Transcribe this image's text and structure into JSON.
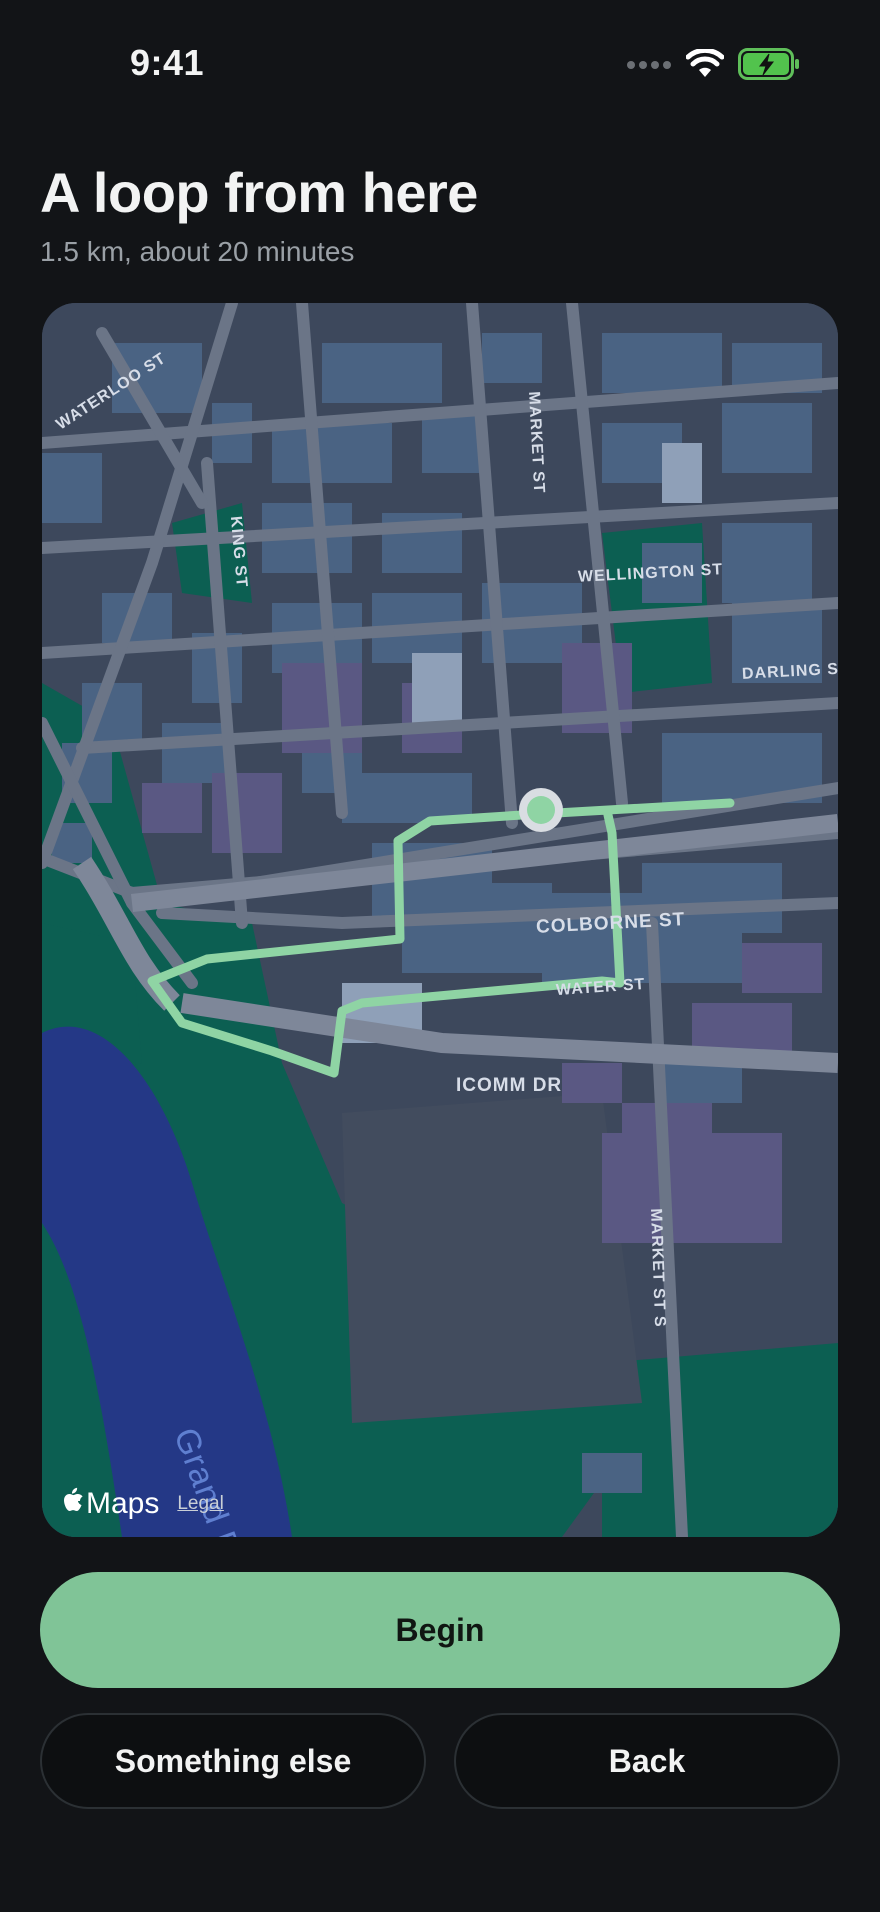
{
  "status_bar": {
    "time": "9:41",
    "icons": [
      "signal-icon",
      "wifi-icon",
      "battery-charging-icon"
    ]
  },
  "header": {
    "title": "A loop from here",
    "subtitle": "1.5 km, about 20 minutes"
  },
  "map": {
    "street_labels": {
      "waterloo": "WATERLOO ST",
      "king": "KING ST",
      "market_n": "MARKET ST",
      "wellington": "WELLINGTON ST",
      "darling": "DARLING ST",
      "colborne": "COLBORNE ST",
      "water": "WATER ST",
      "icomm": "ICOMM DR",
      "market_s": "MARKET ST S",
      "river": "Grand R"
    },
    "attribution": {
      "brand": "Maps",
      "legal": "Legal"
    },
    "route_color": "#8fd4a4"
  },
  "actions": {
    "begin": "Begin",
    "something_else": "Something else",
    "back": "Back"
  }
}
